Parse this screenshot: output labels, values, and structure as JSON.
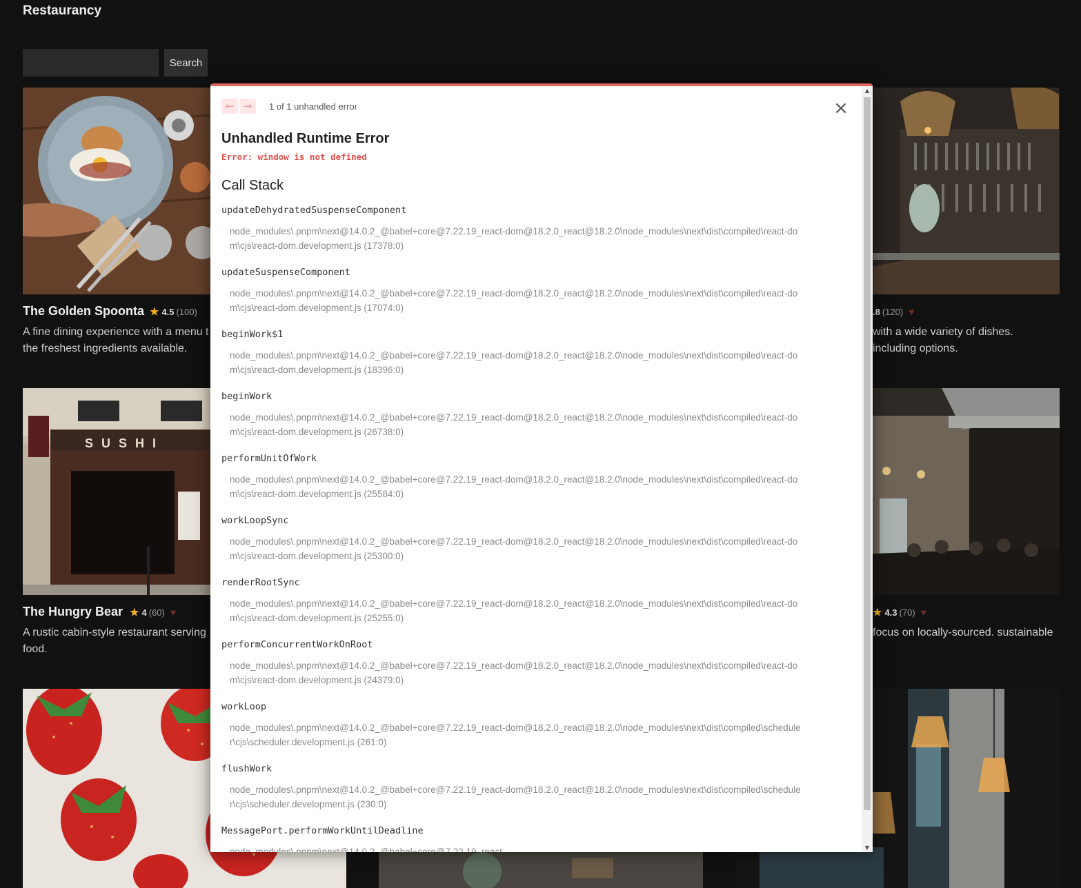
{
  "app": {
    "title": "Restaurancy"
  },
  "search": {
    "value": "",
    "button_label": "Search"
  },
  "restaurants": [
    {
      "name": "The Golden Spoonta",
      "rating": "4.5",
      "reviews": "(100)",
      "description": "A fine dining experience with a menu t the freshest ingredients available."
    },
    {
      "name": "",
      "rating": ".8",
      "reviews": "(120)",
      "description": "with a wide variety of dishes. including options."
    },
    {
      "name": "The Hungry Bear",
      "rating": "4",
      "reviews": "(60)",
      "description": "A rustic cabin-style restaurant serving food."
    },
    {
      "name": "",
      "rating": "4.3",
      "reviews": "(70)",
      "description": "focus on locally-sourced. sustainable"
    }
  ],
  "error_overlay": {
    "counter": "1 of 1 unhandled error",
    "heading": "Unhandled Runtime Error",
    "message": "Error: window is not defined",
    "stack_heading": "Call Stack",
    "frames": [
      {
        "fn": "updateDehydratedSuspenseComponent",
        "file": "node_modules\\.pnpm\\next@14.0.2_@babel+core@7.22.19_react-dom@18.2.0_react@18.2.0\\node_modules\\next\\dist\\compiled\\react-dom\\cjs\\react-dom.development.js (17378:0)"
      },
      {
        "fn": "updateSuspenseComponent",
        "file": "node_modules\\.pnpm\\next@14.0.2_@babel+core@7.22.19_react-dom@18.2.0_react@18.2.0\\node_modules\\next\\dist\\compiled\\react-dom\\cjs\\react-dom.development.js (17074:0)"
      },
      {
        "fn": "beginWork$1",
        "file": "node_modules\\.pnpm\\next@14.0.2_@babel+core@7.22.19_react-dom@18.2.0_react@18.2.0\\node_modules\\next\\dist\\compiled\\react-dom\\cjs\\react-dom.development.js (18396:0)"
      },
      {
        "fn": "beginWork",
        "file": "node_modules\\.pnpm\\next@14.0.2_@babel+core@7.22.19_react-dom@18.2.0_react@18.2.0\\node_modules\\next\\dist\\compiled\\react-dom\\cjs\\react-dom.development.js (26738:0)"
      },
      {
        "fn": "performUnitOfWork",
        "file": "node_modules\\.pnpm\\next@14.0.2_@babel+core@7.22.19_react-dom@18.2.0_react@18.2.0\\node_modules\\next\\dist\\compiled\\react-dom\\cjs\\react-dom.development.js (25584:0)"
      },
      {
        "fn": "workLoopSync",
        "file": "node_modules\\.pnpm\\next@14.0.2_@babel+core@7.22.19_react-dom@18.2.0_react@18.2.0\\node_modules\\next\\dist\\compiled\\react-dom\\cjs\\react-dom.development.js (25300:0)"
      },
      {
        "fn": "renderRootSync",
        "file": "node_modules\\.pnpm\\next@14.0.2_@babel+core@7.22.19_react-dom@18.2.0_react@18.2.0\\node_modules\\next\\dist\\compiled\\react-dom\\cjs\\react-dom.development.js (25255:0)"
      },
      {
        "fn": "performConcurrentWorkOnRoot",
        "file": "node_modules\\.pnpm\\next@14.0.2_@babel+core@7.22.19_react-dom@18.2.0_react@18.2.0\\node_modules\\next\\dist\\compiled\\react-dom\\cjs\\react-dom.development.js (24379:0)"
      },
      {
        "fn": "workLoop",
        "file": "node_modules\\.pnpm\\next@14.0.2_@babel+core@7.22.19_react-dom@18.2.0_react@18.2.0\\node_modules\\next\\dist\\compiled\\scheduler\\cjs\\scheduler.development.js (261:0)"
      },
      {
        "fn": "flushWork",
        "file": "node_modules\\.pnpm\\next@14.0.2_@babel+core@7.22.19_react-dom@18.2.0_react@18.2.0\\node_modules\\next\\dist\\compiled\\scheduler\\cjs\\scheduler.development.js (230:0)"
      },
      {
        "fn": "MessagePort.performWorkUntilDeadline",
        "file": "node_modules\\.pnpm\\next@14.0.2_@babel+core@7.22.19_react-"
      }
    ]
  },
  "icons": {
    "rating": "star-icon",
    "favorite": "heart-icon",
    "prev": "arrow-left-icon",
    "next": "arrow-right-icon",
    "close": "close-icon"
  },
  "colors": {
    "background": "#111111",
    "error_accent": "#e66561",
    "error_text": "#e2504c",
    "star": "#f2b01e"
  }
}
